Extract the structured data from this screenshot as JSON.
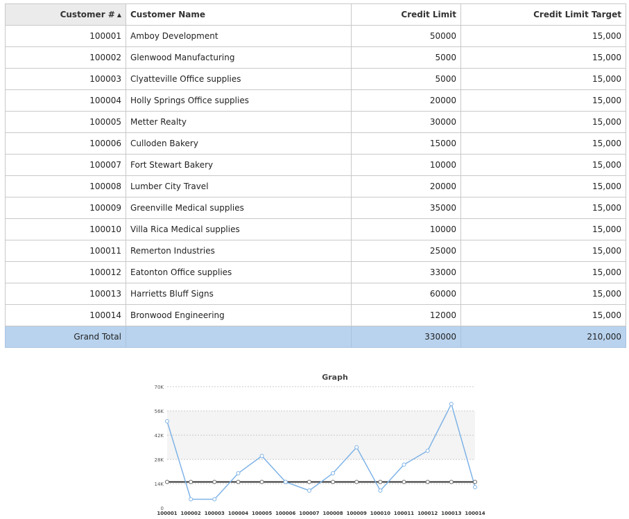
{
  "grid": {
    "columns": {
      "customer_no": "Customer #",
      "customer_name": "Customer Name",
      "credit_limit": "Credit Limit",
      "credit_limit_target": "Credit Limit Target"
    },
    "sorted_column": "customer_no",
    "sort_direction": "ascending",
    "rows": [
      {
        "no": "100001",
        "name": "Amboy Development",
        "limit": "50000",
        "target": "15,000"
      },
      {
        "no": "100002",
        "name": "Glenwood Manufacturing",
        "limit": "5000",
        "target": "15,000"
      },
      {
        "no": "100003",
        "name": "Clyatteville Office supplies",
        "limit": "5000",
        "target": "15,000"
      },
      {
        "no": "100004",
        "name": "Holly Springs Office supplies",
        "limit": "20000",
        "target": "15,000"
      },
      {
        "no": "100005",
        "name": "Metter Realty",
        "limit": "30000",
        "target": "15,000"
      },
      {
        "no": "100006",
        "name": "Culloden Bakery",
        "limit": "15000",
        "target": "15,000"
      },
      {
        "no": "100007",
        "name": "Fort Stewart Bakery",
        "limit": "10000",
        "target": "15,000"
      },
      {
        "no": "100008",
        "name": "Lumber City Travel",
        "limit": "20000",
        "target": "15,000"
      },
      {
        "no": "100009",
        "name": "Greenville Medical supplies",
        "limit": "35000",
        "target": "15,000"
      },
      {
        "no": "100010",
        "name": "Villa Rica Medical supplies",
        "limit": "10000",
        "target": "15,000"
      },
      {
        "no": "100011",
        "name": "Remerton Industries",
        "limit": "25000",
        "target": "15,000"
      },
      {
        "no": "100012",
        "name": "Eatonton Office supplies",
        "limit": "33000",
        "target": "15,000"
      },
      {
        "no": "100013",
        "name": "Harrietts Bluff Signs",
        "limit": "60000",
        "target": "15,000"
      },
      {
        "no": "100014",
        "name": "Bronwood Engineering",
        "limit": "12000",
        "target": "15,000"
      }
    ],
    "total": {
      "label": "Grand Total",
      "limit": "330000",
      "target": "210,000"
    }
  },
  "colors": {
    "total_row": "#b9d3ee",
    "credit_limit_line": "#7fb3e6",
    "target_line": "#333333"
  },
  "chart_data": {
    "type": "line",
    "title": "Graph",
    "categories": [
      "100001",
      "100002",
      "100003",
      "100004",
      "100005",
      "100006",
      "100007",
      "100008",
      "100009",
      "100010",
      "100011",
      "100012",
      "100013",
      "100014"
    ],
    "series": [
      {
        "values": [
          50000,
          5000,
          5000,
          20000,
          30000,
          15000,
          10000,
          20000,
          35000,
          10000,
          25000,
          33000,
          60000,
          12000
        ]
      },
      {
        "values": [
          15000,
          15000,
          15000,
          15000,
          15000,
          15000,
          15000,
          15000,
          15000,
          15000,
          15000,
          15000,
          15000,
          15000
        ]
      }
    ],
    "yticks": [
      0,
      14000,
      28000,
      42000,
      56000,
      70000
    ],
    "ytick_labels": [
      "0",
      "14K",
      "28K",
      "42K",
      "56K",
      "70K"
    ],
    "ylim": [
      0,
      70000
    ],
    "grid": true,
    "legend": "none"
  }
}
